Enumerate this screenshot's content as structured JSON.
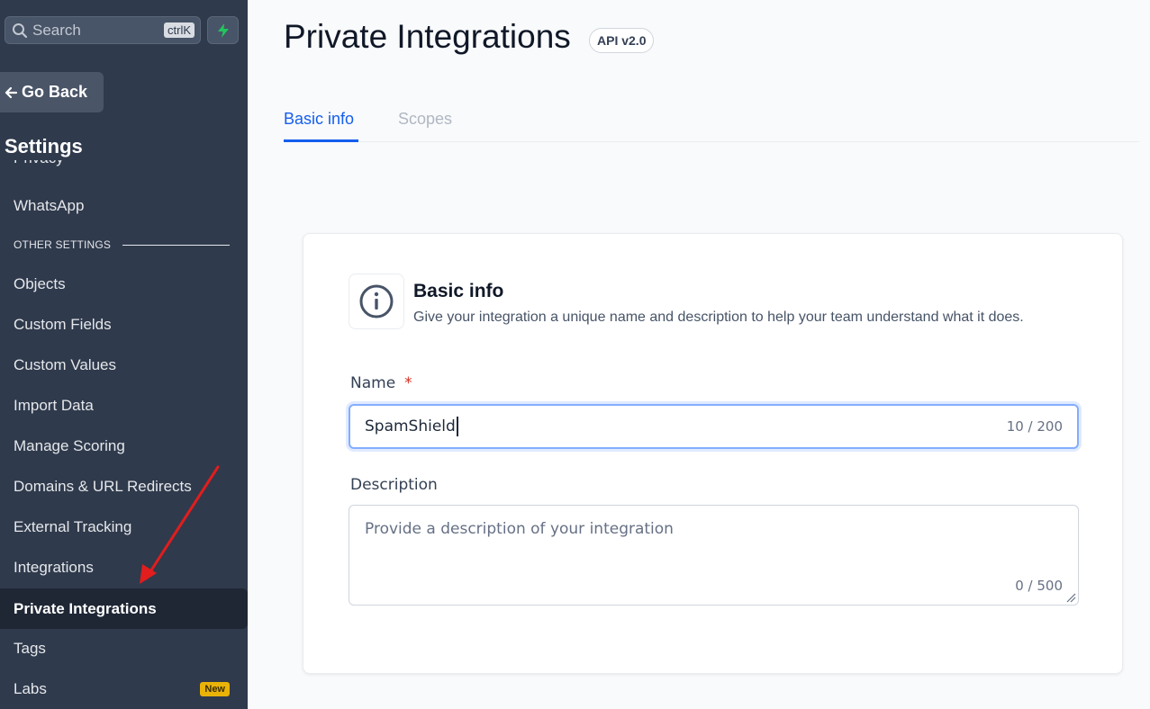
{
  "sidebar": {
    "search_placeholder": "Search",
    "search_shortcut": "ctrlK",
    "go_back_label": "Go Back",
    "settings_title": "Settings",
    "clipped_item": "Privacy",
    "section_label": "OTHER SETTINGS",
    "items": [
      {
        "label": "WhatsApp"
      },
      {
        "label": "Objects"
      },
      {
        "label": "Custom Fields"
      },
      {
        "label": "Custom Values"
      },
      {
        "label": "Import Data"
      },
      {
        "label": "Manage Scoring"
      },
      {
        "label": "Domains & URL Redirects"
      },
      {
        "label": "External Tracking"
      },
      {
        "label": "Integrations"
      },
      {
        "label": "Private Integrations",
        "active": true
      },
      {
        "label": "Tags"
      },
      {
        "label": "Labs",
        "badge": "New"
      }
    ]
  },
  "header": {
    "title": "Private Integrations",
    "api_badge": "API v2.0"
  },
  "tabs": [
    {
      "label": "Basic info",
      "active": true
    },
    {
      "label": "Scopes",
      "active": false
    }
  ],
  "card": {
    "icon": "info-circle-icon",
    "title": "Basic info",
    "subtitle": "Give your integration a unique name and description to help your team understand what it does.",
    "name_label": "Name",
    "name_required_mark": "*",
    "name_value": "SpamShield",
    "name_count": "10 / 200",
    "description_label": "Description",
    "description_placeholder": "Provide a description of your integration",
    "description_count": "0 / 500"
  },
  "colors": {
    "sidebar_bg": "#2f3a4c",
    "accent": "#155eef",
    "bolt": "#22c55e",
    "annotation_arrow": "#e11d1d"
  }
}
